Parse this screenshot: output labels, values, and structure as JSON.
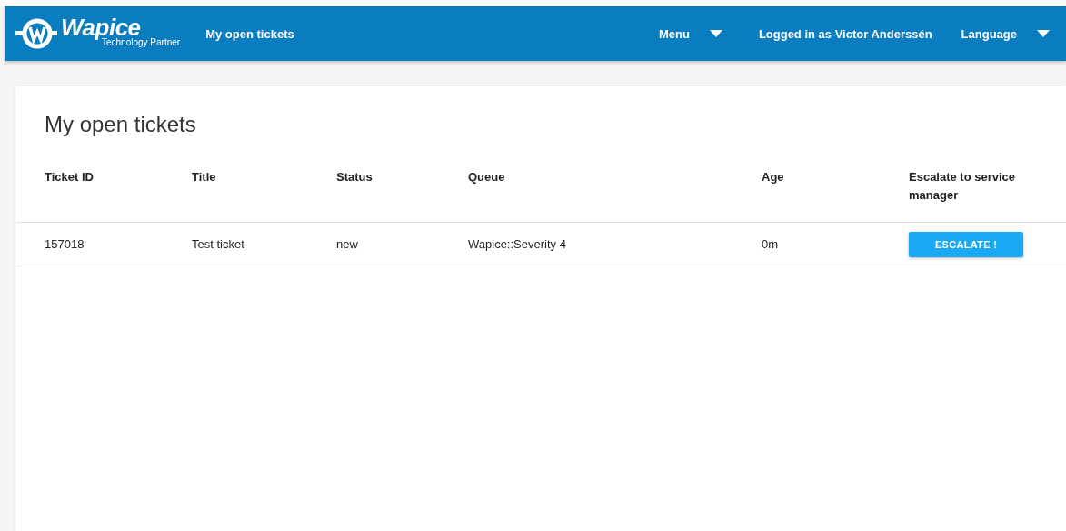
{
  "header": {
    "logo": {
      "name": "Wapice",
      "tagline": "Technology Partner"
    },
    "nav_link": "My open tickets",
    "menu": "Menu",
    "user": "Logged in as Victor Anderssén",
    "language": "Language"
  },
  "page_title": "My open tickets",
  "table": {
    "columns": [
      "Ticket ID",
      "Title",
      "Status",
      "Queue",
      "Age",
      "Escalate to service manager"
    ],
    "rows": [
      {
        "cells": [
          "157018",
          "Test ticket",
          "new",
          "Wapice::Severity 4",
          "0m"
        ],
        "action": "ESCALATE !"
      }
    ]
  }
}
